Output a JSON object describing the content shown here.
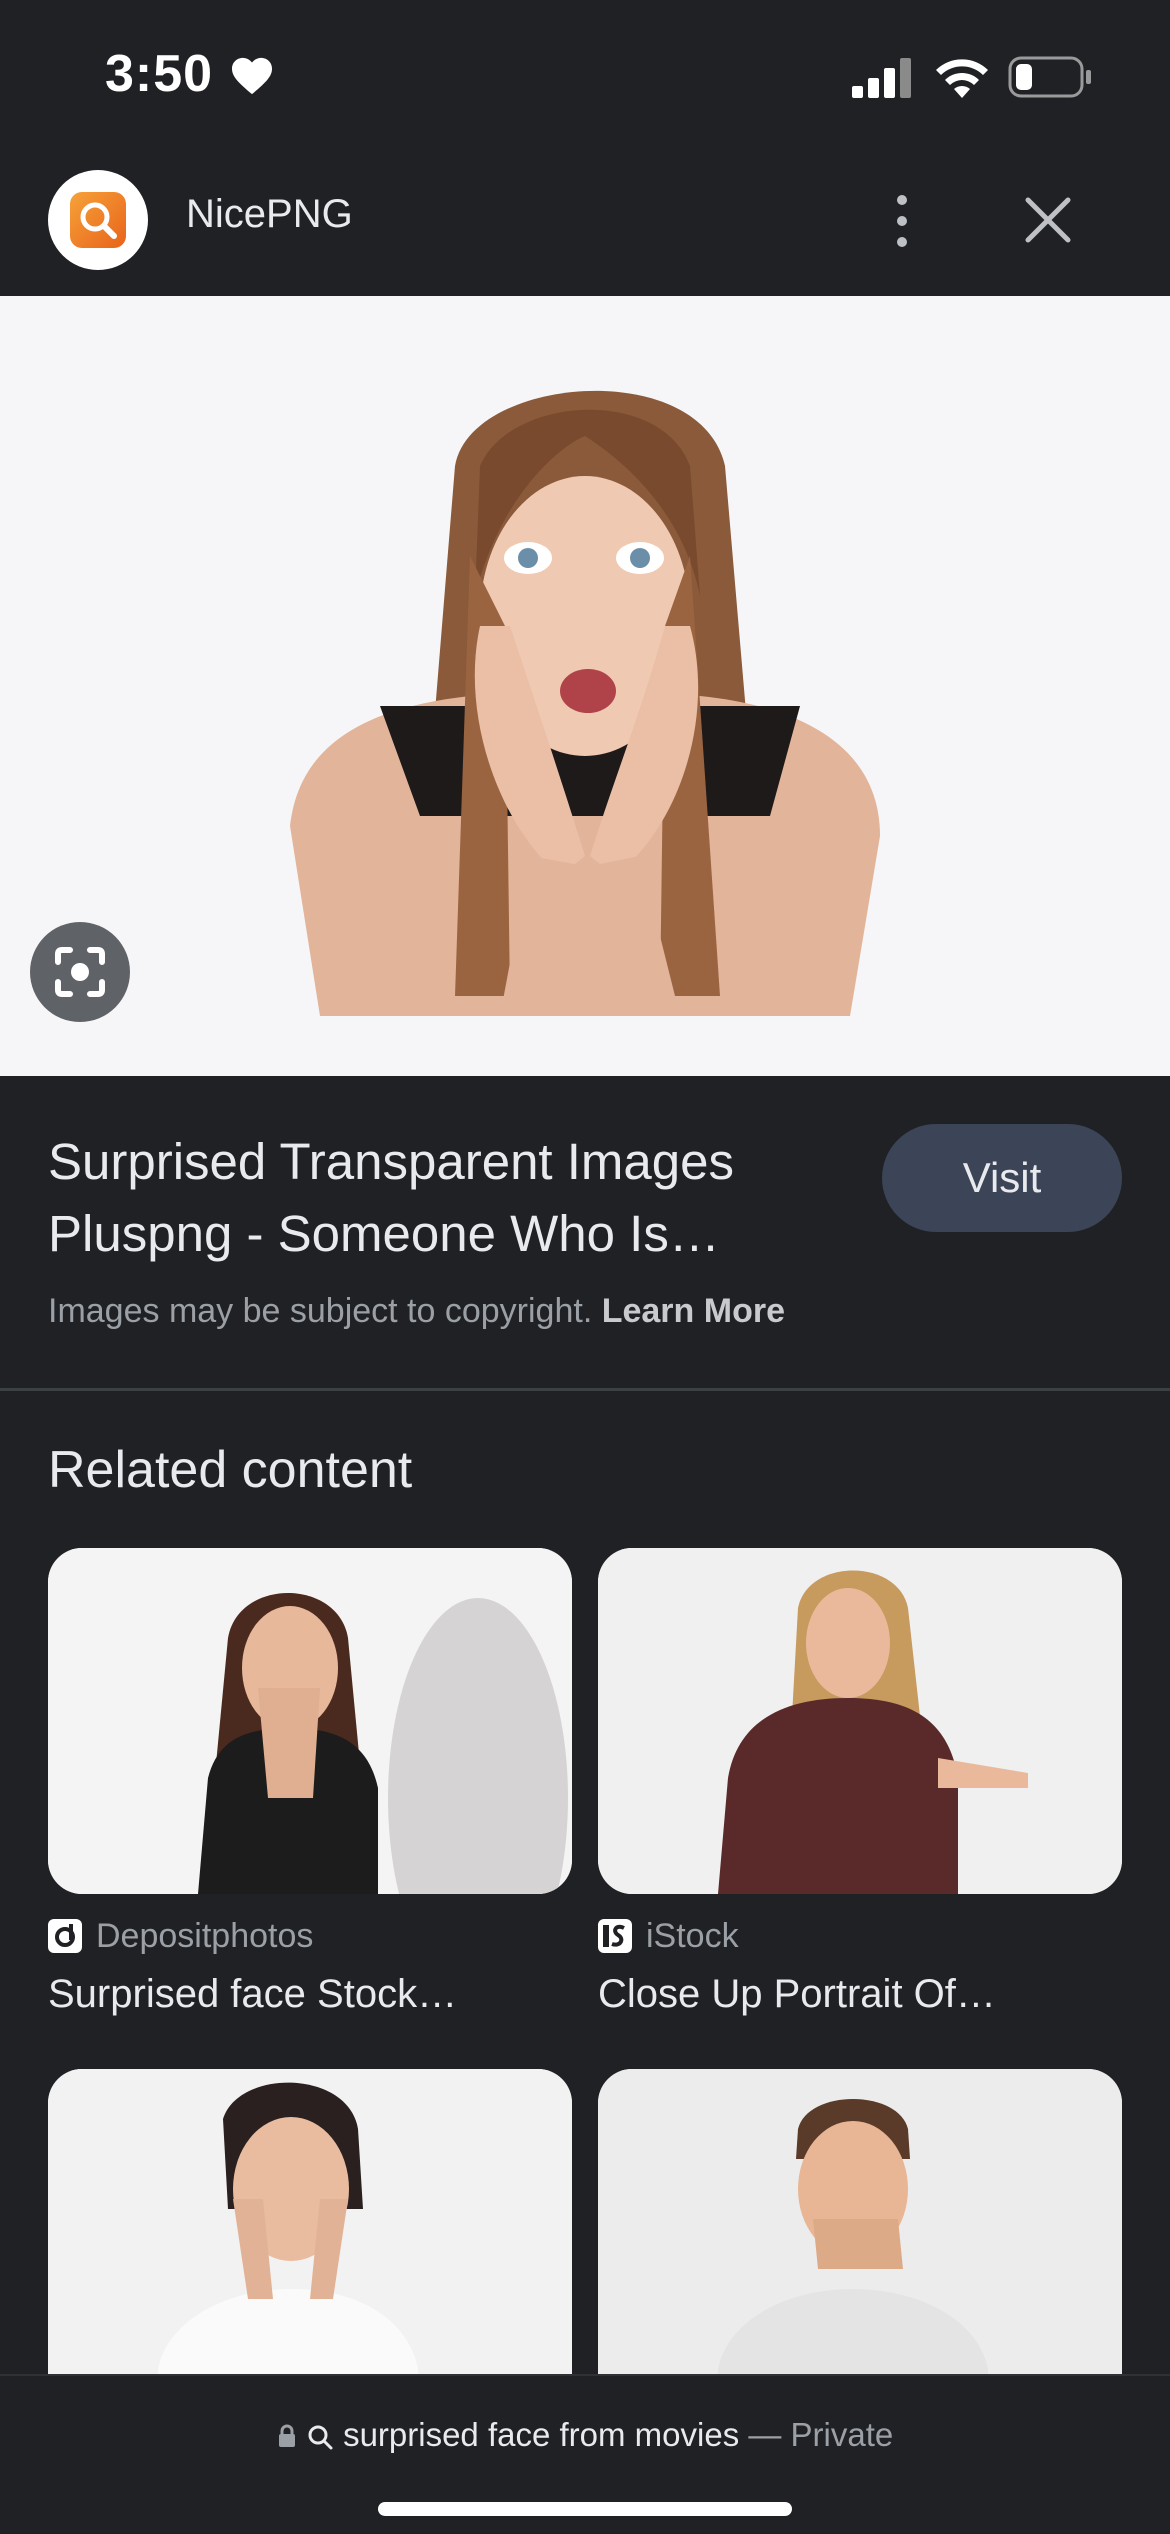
{
  "status_bar": {
    "time": "3:50"
  },
  "site": {
    "name": "NicePNG"
  },
  "result": {
    "title": "Surprised Transparent Images Pluspng - Someone Who Is…",
    "visit_label": "Visit",
    "copyright_text": "Images may be subject to copyright.",
    "learn_more_label": "Learn More"
  },
  "related": {
    "heading": "Related content",
    "items": [
      {
        "source": "Depositphotos",
        "caption": "Surprised face Stock…"
      },
      {
        "source": "iStock",
        "caption": "Close Up Portrait Of…"
      },
      {
        "source": "",
        "caption": ""
      },
      {
        "source": "",
        "caption": ""
      }
    ]
  },
  "bottom_bar": {
    "query": "surprised face from movies",
    "separator": " — ",
    "mode": "Private"
  },
  "colors": {
    "background": "#202124",
    "visit_button": "#3c4457",
    "logo_orange": "#e8631a"
  }
}
